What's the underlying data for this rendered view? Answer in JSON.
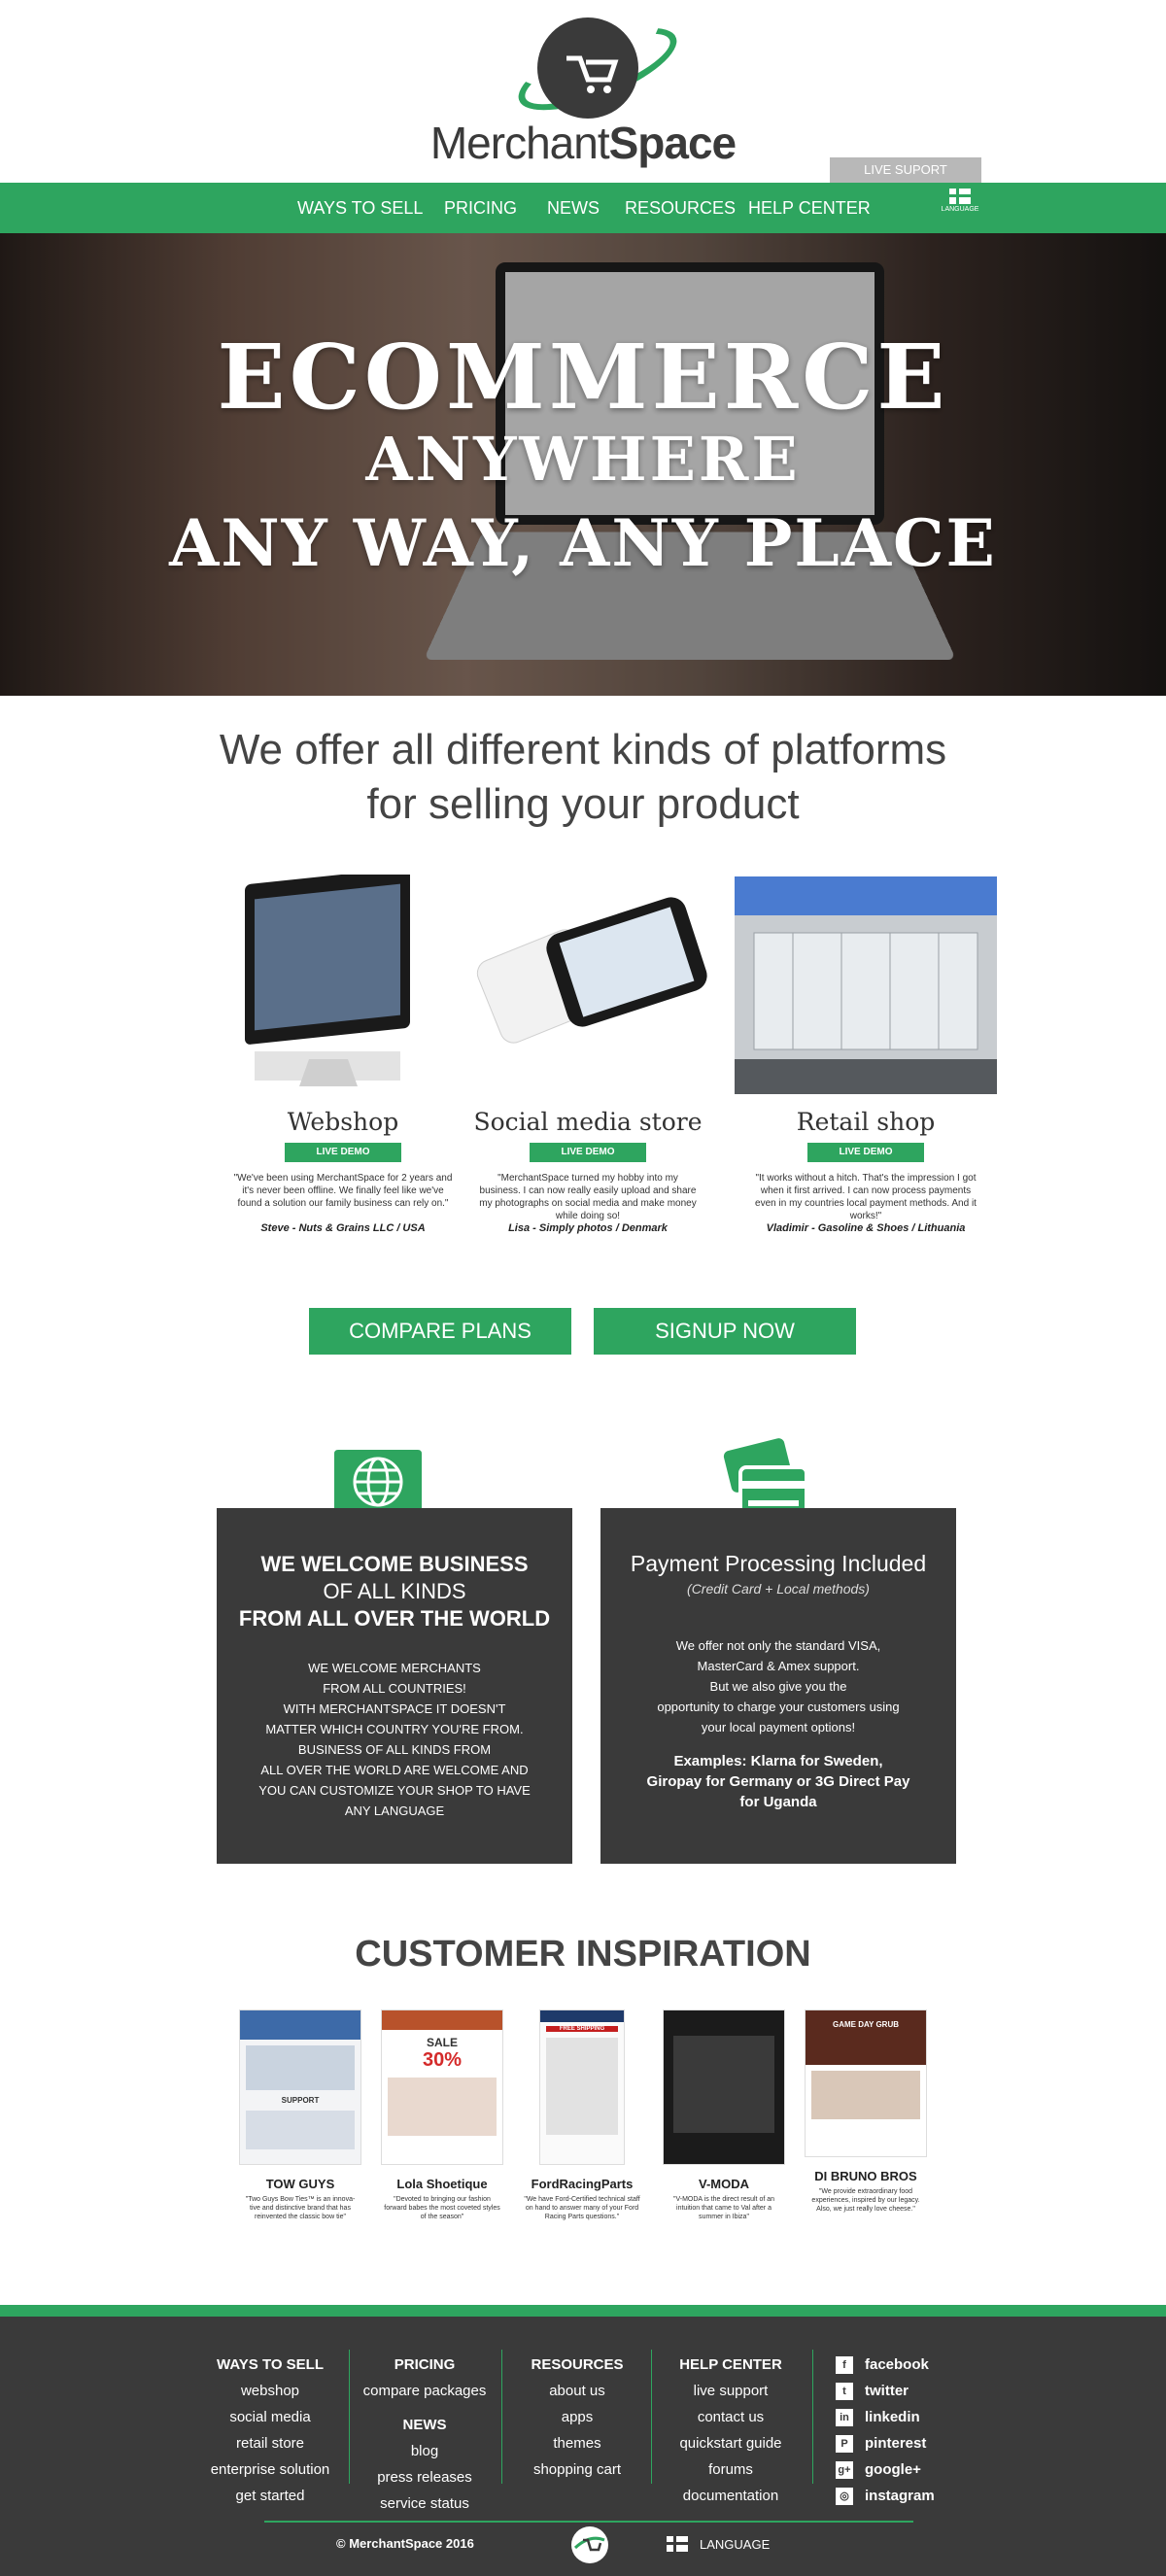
{
  "brand": {
    "name_light": "Merchant",
    "name_bold": "Space",
    "accent": "#2ea55f",
    "dark": "#3a3a3a"
  },
  "header": {
    "live_support": "LIVE SUPORT",
    "language": "LANGUAGE"
  },
  "nav": {
    "items": [
      "WAYS TO SELL",
      "PRICING",
      "NEWS",
      "RESOURCES",
      "HELP CENTER"
    ]
  },
  "hero": {
    "line1": "ECOMMERCE",
    "line2": "ANYWHERE",
    "line3": "ANY WAY, ANY PLACE"
  },
  "platforms": {
    "heading_line1": "We offer all different kinds of platforms",
    "heading_line2": "for selling your product",
    "items": [
      {
        "title": "Webshop",
        "demo": "LIVE DEMO",
        "quote": "\"We've been using MerchantSpace for 2 years and it's never been offline. We finally feel like we've found a solution our family business can rely on.\"",
        "author": "Steve - Nuts & Grains LLC / USA"
      },
      {
        "title": "Social media store",
        "demo": "LIVE DEMO",
        "quote": "\"MerchantSpace turned my hobby into my business. I can now really easily upload and share my photographs on social media and make money while doing so!",
        "author": "Lisa - Simply photos / Denmark"
      },
      {
        "title": "Retail shop",
        "demo": "LIVE DEMO",
        "quote": "\"It works without a hitch. That's the impression I got when it first arrived. I can now process payments even in my countries local payment methods. And it works!\"",
        "author": "Vladimir - Gasoline & Shoes / Lithuania"
      }
    ]
  },
  "cta": {
    "compare": "COMPARE PLANS",
    "signup": "SIGNUP NOW"
  },
  "features": {
    "business": {
      "title_line1": "WE WELCOME BUSINESS",
      "title_line2": "OF ALL KINDS",
      "title_line3": "FROM ALL OVER THE WORLD",
      "body": [
        "WE WELCOME MERCHANTS",
        "FROM ALL COUNTRIES!",
        "WITH MERCHANTSPACE IT DOESN'T",
        "MATTER WHICH COUNTRY YOU'RE FROM.",
        "BUSINESS OF ALL KINDS FROM",
        "ALL OVER THE WORLD ARE WELCOME AND",
        "YOU CAN CUSTOMIZE YOUR SHOP TO HAVE",
        "ANY LANGUAGE"
      ]
    },
    "payment": {
      "title": "Payment Processing Included",
      "subtitle": "(Credit Card + Local methods)",
      "body": [
        "We offer not only the standard VISA,",
        "MasterCard & Amex support.",
        "But we also give you the",
        "opportunity to charge your customers using",
        "your local payment options!"
      ],
      "examples": [
        "Examples: Klarna for Sweden,",
        "Giropay for Germany or 3G Direct Pay",
        "for Uganda"
      ]
    }
  },
  "inspiration": {
    "heading": "CUSTOMER INSPIRATION",
    "items": [
      {
        "name": "TOW GUYS",
        "desc": "\"Two Guys Bow Ties™ is an innova-tive and distinctive brand that has reinvented the classic bow tie\""
      },
      {
        "name": "Lola Shoetique",
        "desc": "\"Devoted to bringing our fashion forward babes the most coveted styles of the season\""
      },
      {
        "name": "FordRacingParts",
        "desc": "\"We have Ford-Certified technical staff on hand to answer many of your Ford Racing Parts questions.\""
      },
      {
        "name": "V-MODA",
        "desc": "\"V-MODA is the direct result of an intuition that came to Val after a summer in Ibiza\""
      },
      {
        "name": "DI BRUNO BROS",
        "desc": "\"We provide extraordinary food experiences, inspired by our legacy. Also, we just really love cheese.\""
      }
    ],
    "thumb_labels": [
      "SUPPORT",
      "SALE",
      "30%",
      "FREE SHIPPING",
      "GAME DAY GRUB"
    ]
  },
  "footer": {
    "ways": {
      "title": "WAYS TO SELL",
      "links": [
        "webshop",
        "social media",
        "retail store",
        "enterprise solution",
        "get started"
      ]
    },
    "pricing": {
      "title": "PRICING",
      "links": [
        "compare packages"
      ]
    },
    "news": {
      "title": "NEWS",
      "links": [
        "blog",
        "press releases",
        "service status"
      ]
    },
    "resources": {
      "title": "RESOURCES",
      "links": [
        "about us",
        "apps",
        "themes",
        "shopping cart"
      ]
    },
    "help": {
      "title": "HELP CENTER",
      "links": [
        "live support",
        "contact us",
        "quickstart guide",
        "forums",
        "documentation"
      ]
    },
    "social": [
      {
        "label": "facebook",
        "icon": "f"
      },
      {
        "label": "twitter",
        "icon": "t"
      },
      {
        "label": "linkedin",
        "icon": "in"
      },
      {
        "label": "pinterest",
        "icon": "P"
      },
      {
        "label": "google+",
        "icon": "g+"
      },
      {
        "label": "instagram",
        "icon": "◎"
      }
    ],
    "copyright": "© MerchantSpace 2016",
    "language": "LANGUAGE"
  }
}
